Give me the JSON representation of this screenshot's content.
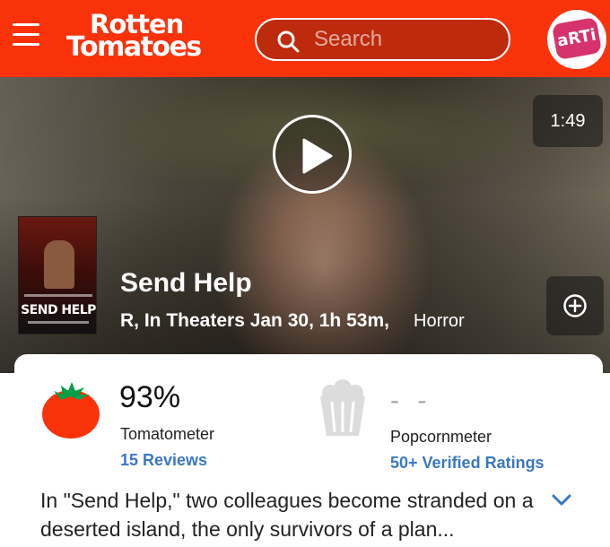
{
  "header": {
    "logo_line1": "Rotten",
    "logo_line2": "Tomatoes",
    "logo_mark": "®",
    "search_placeholder": "Search",
    "avatar_text": "aRTi",
    "brand_color": "#fa320a"
  },
  "hero": {
    "video_duration": "1:49",
    "poster_title": "SEND HELP",
    "title": "Send Help",
    "meta": "R, In Theaters Jan 30, 1h 53m,",
    "genre": "Horror",
    "icons": [
      "play-icon",
      "add-circle-icon"
    ]
  },
  "scores": {
    "tomatometer_value": "93%",
    "tomatometer_label": "Tomatometer",
    "tomatometer_reviews": "15 Reviews",
    "popcornmeter_value": "- -",
    "popcornmeter_label": "Popcornmeter",
    "popcornmeter_ratings": "50+ Verified Ratings",
    "link_color": "#3a78c2"
  },
  "synopsis": {
    "text": "In \"Send Help,\" two colleagues become stranded on a deserted island, the only survivors of a plan..."
  }
}
